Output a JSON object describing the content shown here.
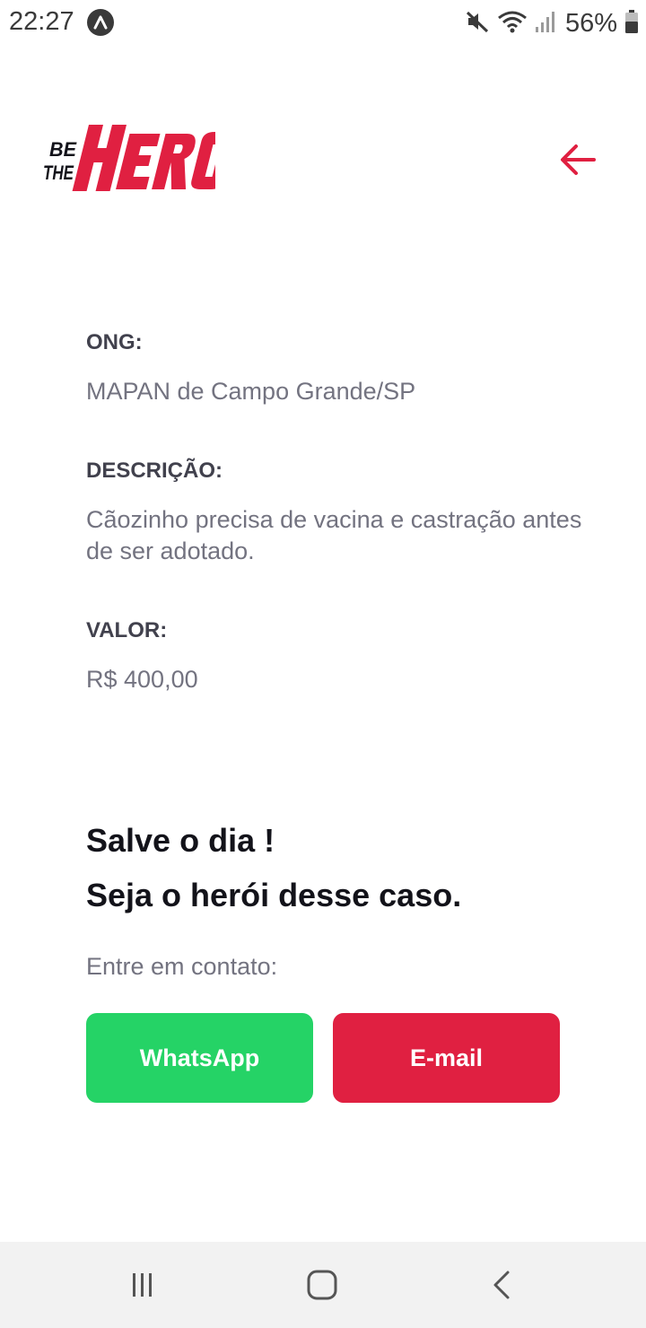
{
  "status_bar": {
    "time": "22:27",
    "battery_percent": "56%",
    "icons": [
      "app-notification-icon",
      "mute-icon",
      "wifi-icon",
      "signal-icon",
      "battery-icon"
    ]
  },
  "header": {
    "logo_icon": "be-the-hero-logo",
    "back_icon": "arrow-left-icon"
  },
  "incident": {
    "ong_label": "ONG:",
    "ong_value": "MAPAN de Campo Grande/SP",
    "description_label": "DESCRIÇÃO:",
    "description_value": "Cãozinho precisa de vacina e castração antes de ser adotado.",
    "value_label": "VALOR:",
    "value_value": "R$ 400,00"
  },
  "contact": {
    "title_line1": "Salve o dia !",
    "title_line2": "Seja o herói desse caso.",
    "description": "Entre em contato:",
    "whatsapp_label": "WhatsApp",
    "email_label": "E-mail"
  },
  "nav_bar": {
    "icons": [
      "recent-apps-icon",
      "home-icon",
      "back-icon"
    ]
  },
  "colors": {
    "brand_red": "#e02041",
    "whatsapp_green": "#25d366",
    "title": "#13131a",
    "label": "#41414d",
    "text": "#737380",
    "nav_background": "#f2f2f2"
  }
}
